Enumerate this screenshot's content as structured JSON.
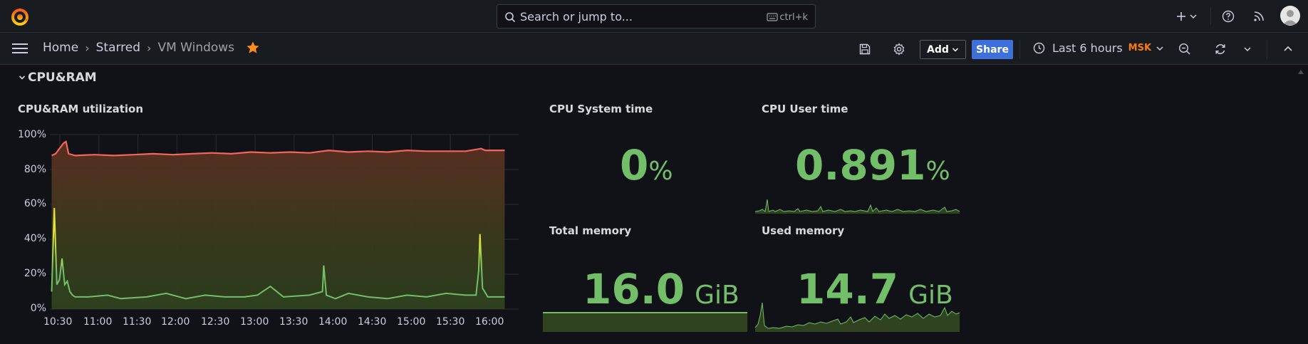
{
  "search": {
    "placeholder": "Search or jump to...",
    "shortcut": "ctrl+k"
  },
  "breadcrumb": {
    "home": "Home",
    "starred": "Starred",
    "current": "VM Windows"
  },
  "toolbar": {
    "add_label": "Add",
    "share_label": "Share",
    "time_range": "Last 6 hours",
    "timezone": "MSK"
  },
  "row": {
    "title": "CPU&RAM"
  },
  "panels": {
    "cpu_ram_title": "CPU&RAM utilization",
    "cpu_system": {
      "title": "CPU System time",
      "value": "0",
      "unit": "%"
    },
    "cpu_user": {
      "title": "CPU User time",
      "value": "0.891",
      "unit": "%"
    },
    "total_memory": {
      "title": "Total memory",
      "value": "16.0",
      "unit": "GiB"
    },
    "used_memory": {
      "title": "Used memory",
      "value": "14.7",
      "unit": "GiB"
    }
  },
  "colors": {
    "ram": "#f2665c",
    "cpu_green": "#73bf69",
    "cpu_yellow": "#e0e53a",
    "accent": "#ff780a",
    "share": "#3d71d9"
  },
  "chart_data": {
    "type": "line",
    "title": "CPU&RAM utilization",
    "y_ticks": [
      "100%",
      "80%",
      "60%",
      "40%",
      "20%",
      "0%"
    ],
    "ylim": [
      0,
      100
    ],
    "x_ticks": [
      "10:30",
      "11:00",
      "11:30",
      "12:00",
      "12:30",
      "13:00",
      "13:30",
      "14:00",
      "14:30",
      "15:00",
      "15:30",
      "16:00"
    ],
    "grid": true,
    "series": [
      {
        "x": [
          "10:27",
          "10:30",
          "10:33",
          "10:36",
          "10:38",
          "10:40",
          "10:45",
          "11:00",
          "11:15",
          "11:30",
          "11:45",
          "12:00",
          "12:15",
          "12:30",
          "12:45",
          "13:00",
          "13:15",
          "13:30",
          "13:45",
          "14:00",
          "14:15",
          "14:30",
          "14:45",
          "15:00",
          "15:15",
          "15:30",
          "15:45",
          "15:57",
          "16:00",
          "16:10",
          "16:15"
        ],
        "y": [
          88,
          89,
          92,
          95,
          96,
          89,
          88,
          88.5,
          88,
          88.5,
          89,
          88.5,
          89,
          89.5,
          89,
          90,
          89.5,
          90,
          89.5,
          91,
          90,
          90.5,
          90,
          91,
          90.5,
          90.5,
          90.5,
          92,
          91,
          91,
          91
        ]
      },
      {
        "x": [
          "10:27",
          "10:29",
          "10:31",
          "10:33",
          "10:35",
          "10:37",
          "10:39",
          "10:41",
          "10:43",
          "10:45",
          "10:55",
          "11:10",
          "11:20",
          "11:40",
          "11:55",
          "12:10",
          "12:25",
          "12:40",
          "12:55",
          "13:05",
          "13:15",
          "13:25",
          "13:45",
          "13:55",
          "13:56",
          "13:58",
          "14:05",
          "14:15",
          "14:30",
          "14:45",
          "15:00",
          "15:15",
          "15:30",
          "15:45",
          "15:53",
          "15:55",
          "15:56",
          "15:58",
          "16:02",
          "16:08",
          "16:15"
        ],
        "y": [
          10,
          58,
          14,
          17,
          29,
          14,
          16,
          10,
          8,
          7,
          7,
          8,
          6,
          7,
          9,
          6,
          8,
          7,
          7,
          8,
          13,
          7,
          8,
          10,
          25,
          8,
          6,
          9,
          7,
          6,
          8,
          7,
          9,
          8,
          8,
          22,
          43,
          12,
          7,
          7,
          7
        ]
      }
    ]
  }
}
